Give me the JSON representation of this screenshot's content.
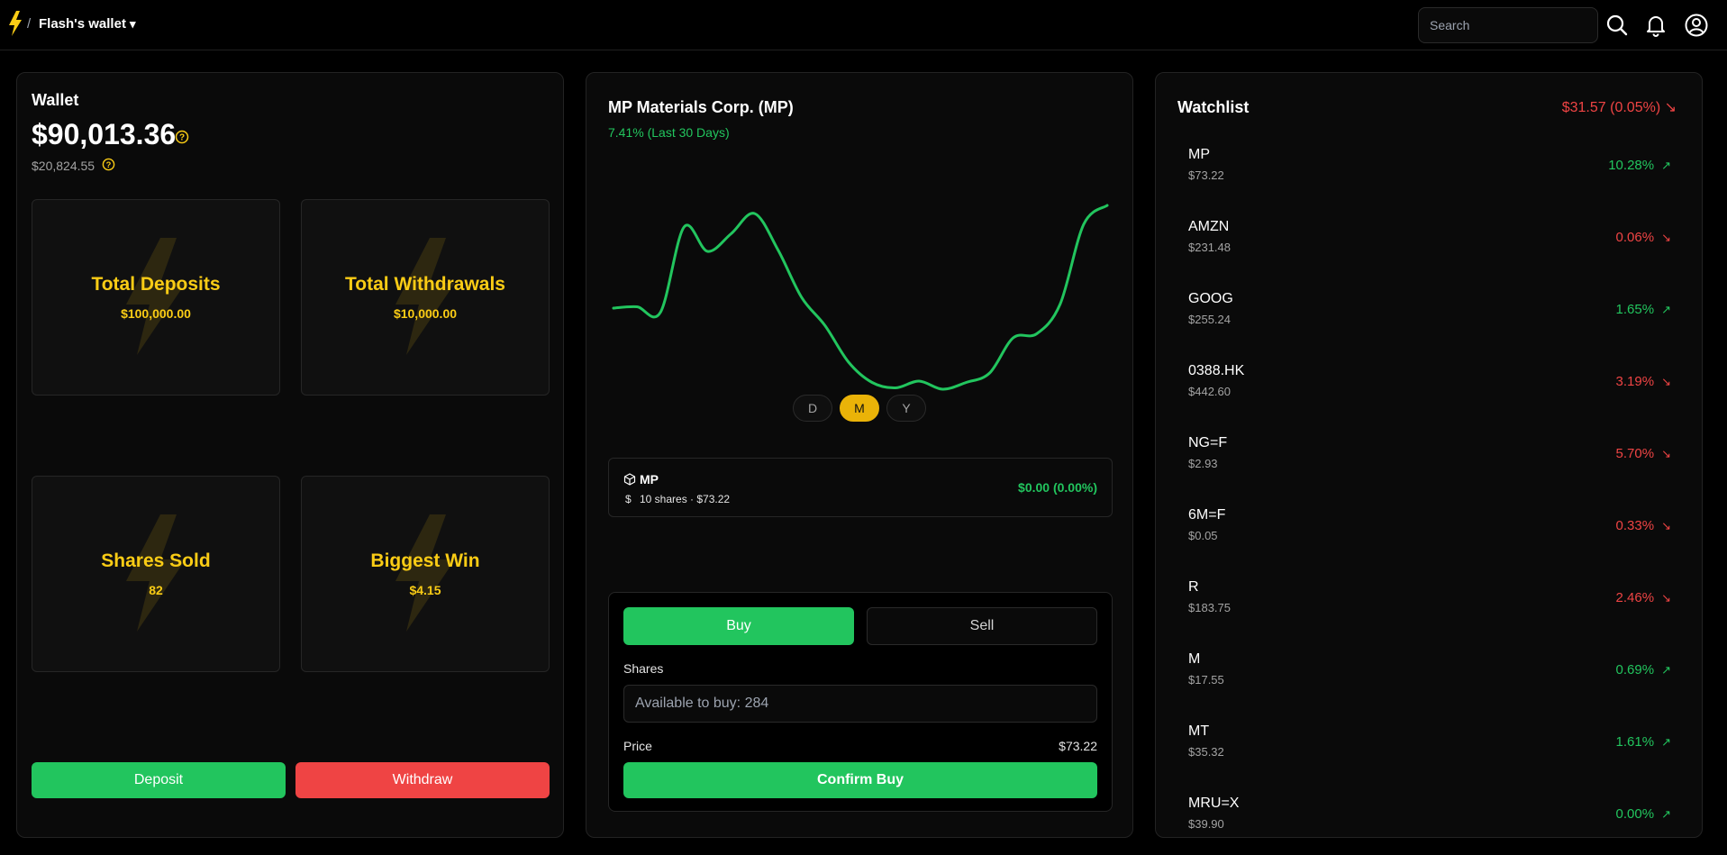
{
  "header": {
    "separator": "/",
    "wallet_name": "Flash's wallet",
    "caret": "▾",
    "search_placeholder": "Search",
    "icons": [
      "lightning-logo-icon",
      "search-icon",
      "bell-icon",
      "user-icon"
    ]
  },
  "colors": {
    "accent_yellow": "#facc15",
    "positive": "#22c55e",
    "negative": "#ef4444",
    "background": "#000000",
    "panel": "#0a0a0a"
  },
  "wallet": {
    "title": "Wallet",
    "balance": "$90,013.36",
    "sub_balance": "$20,824.55",
    "stats": [
      {
        "label": "Total Deposits",
        "value": "$100,000.00"
      },
      {
        "label": "Total Withdrawals",
        "value": "$10,000.00"
      },
      {
        "label": "Shares Sold",
        "value": "82"
      },
      {
        "label": "Biggest Win",
        "value": "$4.15"
      }
    ],
    "deposit_label": "Deposit",
    "withdraw_label": "Withdraw"
  },
  "stock": {
    "title": "MP Materials Corp. (MP)",
    "change": "7.41% (Last 30 Days)",
    "ranges": [
      "D",
      "M",
      "Y"
    ],
    "active_range": "M",
    "holding": {
      "symbol": "MP",
      "dollar": "$",
      "shares": "10 shares · $73.22",
      "pl": "$0.00 (0.00%)"
    },
    "trade": {
      "buy_label": "Buy",
      "sell_label": "Sell",
      "shares_label": "Shares",
      "shares_placeholder": "Available to buy: 284",
      "price_label": "Price",
      "price_value": "$73.22",
      "confirm_label": "Confirm Buy"
    }
  },
  "chart_data": {
    "type": "line",
    "title": "",
    "xlabel": "",
    "ylabel": "",
    "series": [
      {
        "values": [
          63.6,
          63.7,
          63.3,
          69.6,
          67.8,
          69.1,
          70.6,
          67.9,
          64.4,
          62.3,
          59.6,
          58.1,
          57.7,
          58.2,
          57.6,
          58.1,
          58.8,
          61.4,
          61.7,
          63.9,
          69.8,
          71.2
        ]
      }
    ],
    "ylim": [
      55,
      73
    ],
    "grid": false
  },
  "watchlist": {
    "title": "Watchlist",
    "total": "$31.57 (0.05%) ↘",
    "items": [
      {
        "symbol": "MP",
        "price": "$73.22",
        "pct": "10.28%",
        "arrow": "↗",
        "dir": "up"
      },
      {
        "symbol": "AMZN",
        "price": "$231.48",
        "pct": "0.06%",
        "arrow": "↘",
        "dir": "down"
      },
      {
        "symbol": "GOOG",
        "price": "$255.24",
        "pct": "1.65%",
        "arrow": "↗",
        "dir": "up"
      },
      {
        "symbol": "0388.HK",
        "price": "$442.60",
        "pct": "3.19%",
        "arrow": "↘",
        "dir": "down"
      },
      {
        "symbol": "NG=F",
        "price": "$2.93",
        "pct": "5.70%",
        "arrow": "↘",
        "dir": "down"
      },
      {
        "symbol": "6M=F",
        "price": "$0.05",
        "pct": "0.33%",
        "arrow": "↘",
        "dir": "down"
      },
      {
        "symbol": "R",
        "price": "$183.75",
        "pct": "2.46%",
        "arrow": "↘",
        "dir": "down"
      },
      {
        "symbol": "M",
        "price": "$17.55",
        "pct": "0.69%",
        "arrow": "↗",
        "dir": "up"
      },
      {
        "symbol": "MT",
        "price": "$35.32",
        "pct": "1.61%",
        "arrow": "↗",
        "dir": "up"
      },
      {
        "symbol": "MRU=X",
        "price": "$39.90",
        "pct": "0.00%",
        "arrow": "↗",
        "dir": "up"
      }
    ]
  }
}
